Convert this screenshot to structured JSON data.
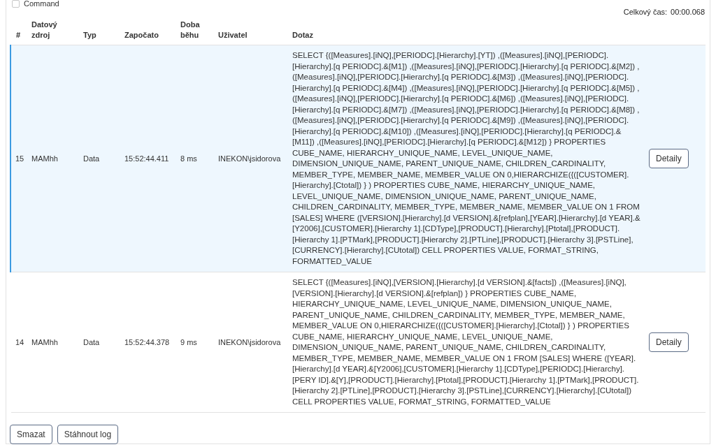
{
  "command_checkbox": {
    "label": "Command",
    "checked": false
  },
  "total_time": {
    "label": "Celkový čas:",
    "value": "00:00.068"
  },
  "table": {
    "columns": [
      "#",
      "Datový zdroj",
      "Typ",
      "Započato",
      "Doba běhu",
      "Uživatel",
      "Dotaz"
    ],
    "rows": [
      {
        "selected": true,
        "number": "15",
        "data_source": "MAMhh",
        "type": "Data",
        "started": "15:52:44.411",
        "duration": "8 ms",
        "user": "INEKON\\jsidorova",
        "query": "SELECT {([Measures].[iNQ],[PERIODC].[Hierarchy].[YT]) ,([Measures].[iNQ],[PERIODC].[Hierarchy].[q PERIODC].&[M1]) ,([Measures].[iNQ],[PERIODC].[Hierarchy].[q PERIODC].&[M2]) ,([Measures].[iNQ],[PERIODC].[Hierarchy].[q PERIODC].&[M3]) ,([Measures].[iNQ],[PERIODC].[Hierarchy].[q PERIODC].&[M4]) ,([Measures].[iNQ],[PERIODC].[Hierarchy].[q PERIODC].&[M5]) ,([Measures].[iNQ],[PERIODC].[Hierarchy].[q PERIODC].&[M6]) ,([Measures].[iNQ],[PERIODC].[Hierarchy].[q PERIODC].&[M7]) ,([Measures].[iNQ],[PERIODC].[Hierarchy].[q PERIODC].&[M8]) ,([Measures].[iNQ],[PERIODC].[Hierarchy].[q PERIODC].&[M9]) ,([Measures].[iNQ],[PERIODC].[Hierarchy].[q PERIODC].&[M10]) ,([Measures].[iNQ],[PERIODC].[Hierarchy].[q PERIODC].&[M11]) ,([Measures].[iNQ],[PERIODC].[Hierarchy].[q PERIODC].&[M12]) } PROPERTIES CUBE_NAME, HIERARCHY_UNIQUE_NAME, LEVEL_UNIQUE_NAME, DIMENSION_UNIQUE_NAME, PARENT_UNIQUE_NAME, CHILDREN_CARDINALITY, MEMBER_TYPE, MEMBER_NAME, MEMBER_VALUE ON 0,HIERARCHIZE({([CUSTOMER].[Hierarchy].[Ctotal]) } ) PROPERTIES CUBE_NAME, HIERARCHY_UNIQUE_NAME, LEVEL_UNIQUE_NAME, DIMENSION_UNIQUE_NAME, PARENT_UNIQUE_NAME, CHILDREN_CARDINALITY, MEMBER_TYPE, MEMBER_NAME, MEMBER_VALUE ON 1 FROM [SALES] WHERE ([VERSION].[Hierarchy].[d VERSION].&[refplan],[YEAR].[Hierarchy].[d YEAR].&[Y2006],[CUSTOMER].[Hierarchy 1].[CDType],[PRODUCT].[Hierarchy].[Ptotal],[PRODUCT].[Hierarchy 1].[PTMark],[PRODUCT].[Hierarchy 2].[PTLine],[PRODUCT].[Hierarchy 3].[PSTLine],[CURRENCY].[Hierarchy].[CUtotal]) CELL PROPERTIES VALUE, FORMAT_STRING, FORMATTED_VALUE",
        "action": "Detaily"
      },
      {
        "selected": false,
        "number": "14",
        "data_source": "MAMhh",
        "type": "Data",
        "started": "15:52:44.378",
        "duration": "9 ms",
        "user": "INEKON\\jsidorova",
        "query": "SELECT {([Measures].[iNQ],[VERSION].[Hierarchy].[d VERSION].&[facts]) ,([Measures].[iNQ],[VERSION].[Hierarchy].[d VERSION].&[refplan]) } PROPERTIES CUBE_NAME, HIERARCHY_UNIQUE_NAME, LEVEL_UNIQUE_NAME, DIMENSION_UNIQUE_NAME, PARENT_UNIQUE_NAME, CHILDREN_CARDINALITY, MEMBER_TYPE, MEMBER_NAME, MEMBER_VALUE ON 0,HIERARCHIZE({([CUSTOMER].[Hierarchy].[Ctotal]) } ) PROPERTIES CUBE_NAME, HIERARCHY_UNIQUE_NAME, LEVEL_UNIQUE_NAME, DIMENSION_UNIQUE_NAME, PARENT_UNIQUE_NAME, CHILDREN_CARDINALITY, MEMBER_TYPE, MEMBER_NAME, MEMBER_VALUE ON 1 FROM [SALES] WHERE ([YEAR].[Hierarchy].[d YEAR].&[Y2006],[CUSTOMER].[Hierarchy 1].[CDType],[PERIODC].[Hierarchy].[PERY ID].&[Y],[PRODUCT].[Hierarchy].[Ptotal],[PRODUCT].[Hierarchy 1].[PTMark],[PRODUCT].[Hierarchy 2].[PTLine],[PRODUCT].[Hierarchy 3].[PSTLine],[CURRENCY].[Hierarchy].[CUtotal]) CELL PROPERTIES VALUE, FORMAT_STRING, FORMATTED_VALUE",
        "action": "Detaily"
      }
    ]
  },
  "buttons": [
    "Smazat",
    "Stáhnout log"
  ]
}
